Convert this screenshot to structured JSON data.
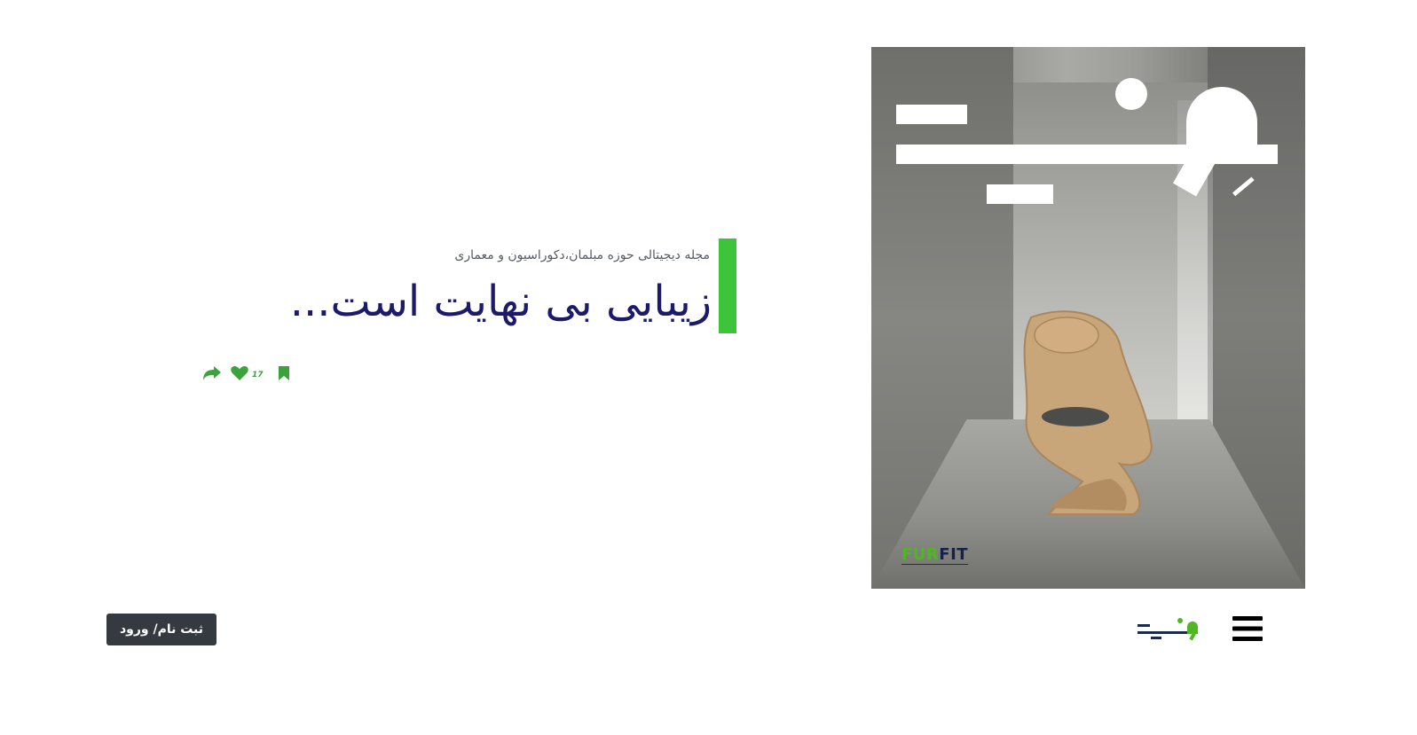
{
  "cover": {
    "logo_icon": "vofit-logo-icon",
    "brand_prefix": "FUR",
    "brand_suffix": "FIT"
  },
  "hero": {
    "subtitle": "مجله دیجیتالی حوزه مبلمان،دکوراسیون  و معماری",
    "headline": "زیبایی بی نهایت  است...",
    "accent_color": "#3ec43b",
    "headline_color": "#1b1a6b"
  },
  "actions": {
    "like_count": "17",
    "icon_color": "#3aa33a",
    "icons": [
      "bookmark-icon",
      "heart-icon",
      "share-icon"
    ]
  },
  "footer": {
    "auth_label": "ثبت نام/ ورود",
    "logo_icon": "vofit-logo-icon",
    "menu_icon": "hamburger-menu-icon"
  }
}
